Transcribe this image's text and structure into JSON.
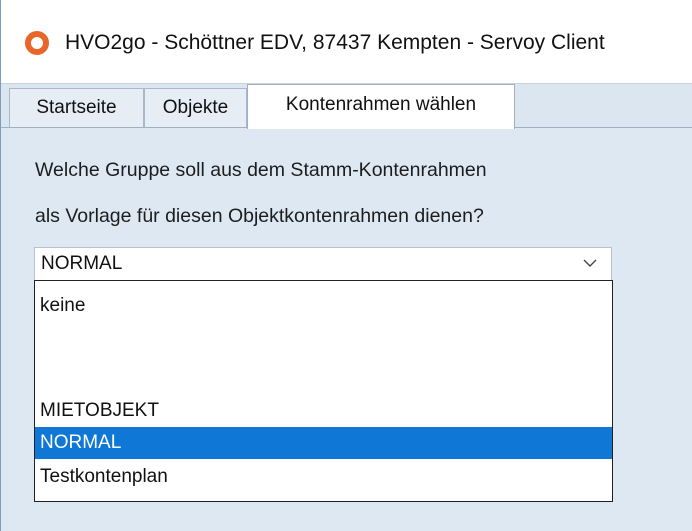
{
  "window": {
    "title": "HVO2go - Schöttner EDV, 87437 Kempten  - Servoy Client",
    "icon": "app-logo-icon"
  },
  "tabs": [
    {
      "label": "Startseite",
      "active": false
    },
    {
      "label": "Objekte",
      "active": false
    },
    {
      "label": "Kontenrahmen wählen",
      "active": true
    }
  ],
  "form": {
    "prompt_line_1": "Welche Gruppe soll aus dem Stamm-Kontenrahmen",
    "prompt_line_2": "als Vorlage für diesen Objektkontenrahmen dienen?",
    "combo": {
      "selected": "NORMAL",
      "icon": "chevron-down-icon"
    },
    "options": [
      {
        "label": "keine",
        "highlighted": false
      },
      {
        "label": "",
        "highlighted": false
      },
      {
        "label": "MIETOBJEKT",
        "highlighted": false
      },
      {
        "label": "NORMAL",
        "highlighted": true
      },
      {
        "label": "Testkontenplan",
        "highlighted": false
      }
    ]
  },
  "colors": {
    "accent": "#0f78d7",
    "logo": "#e8662a",
    "background": "#dde8f3"
  }
}
